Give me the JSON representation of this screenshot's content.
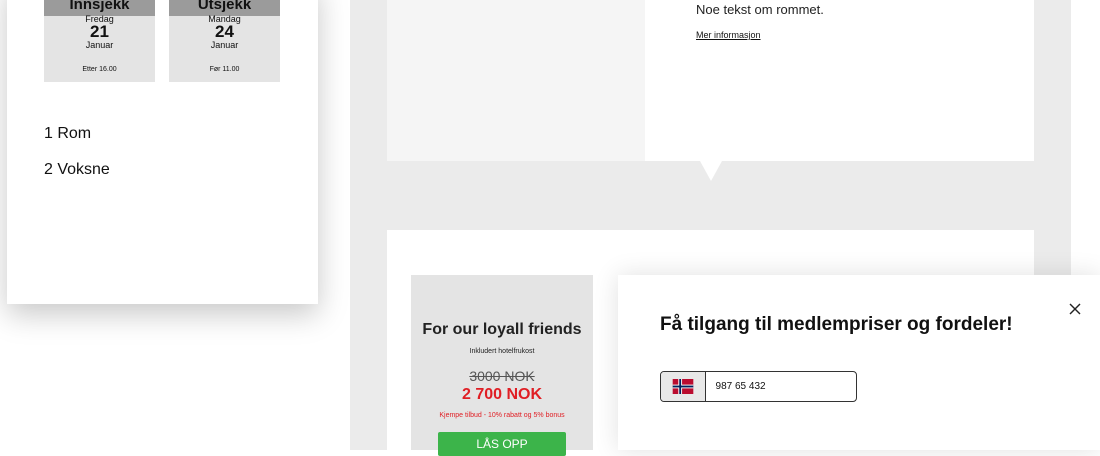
{
  "booking": {
    "checkin": {
      "label": "Innsjekk",
      "weekday": "Fredag",
      "day": "21",
      "month": "Januar",
      "time": "Etter 16.00"
    },
    "checkout": {
      "label": "Utsjekk",
      "weekday": "Mandag",
      "day": "24",
      "month": "Januar",
      "time": "Før 11.00"
    },
    "rooms": "1 Rom",
    "guests": "2 Voksne"
  },
  "room": {
    "description": "Noe tekst om rommet.",
    "more_link": "Mer informasjon"
  },
  "offer": {
    "title": "For our loyall friends",
    "subtitle": "Inkludert hotelfrukost",
    "old_price": "3000 NOK",
    "new_price": "2 700 NOK",
    "promo": "Kjempe tilbud - 10% rabatt og 5% bonus",
    "unlock_button": "LÅS OPP"
  },
  "popup": {
    "heading": "Få tilgang til medlempriser og fordeler!",
    "phone_value": "987 65 432",
    "country_flag": "norway-flag-icon",
    "close_icon": "close-icon"
  },
  "colors": {
    "accent_red": "#e01e24",
    "button_green": "#3cb44a",
    "header_grey": "#9b9b9b"
  }
}
